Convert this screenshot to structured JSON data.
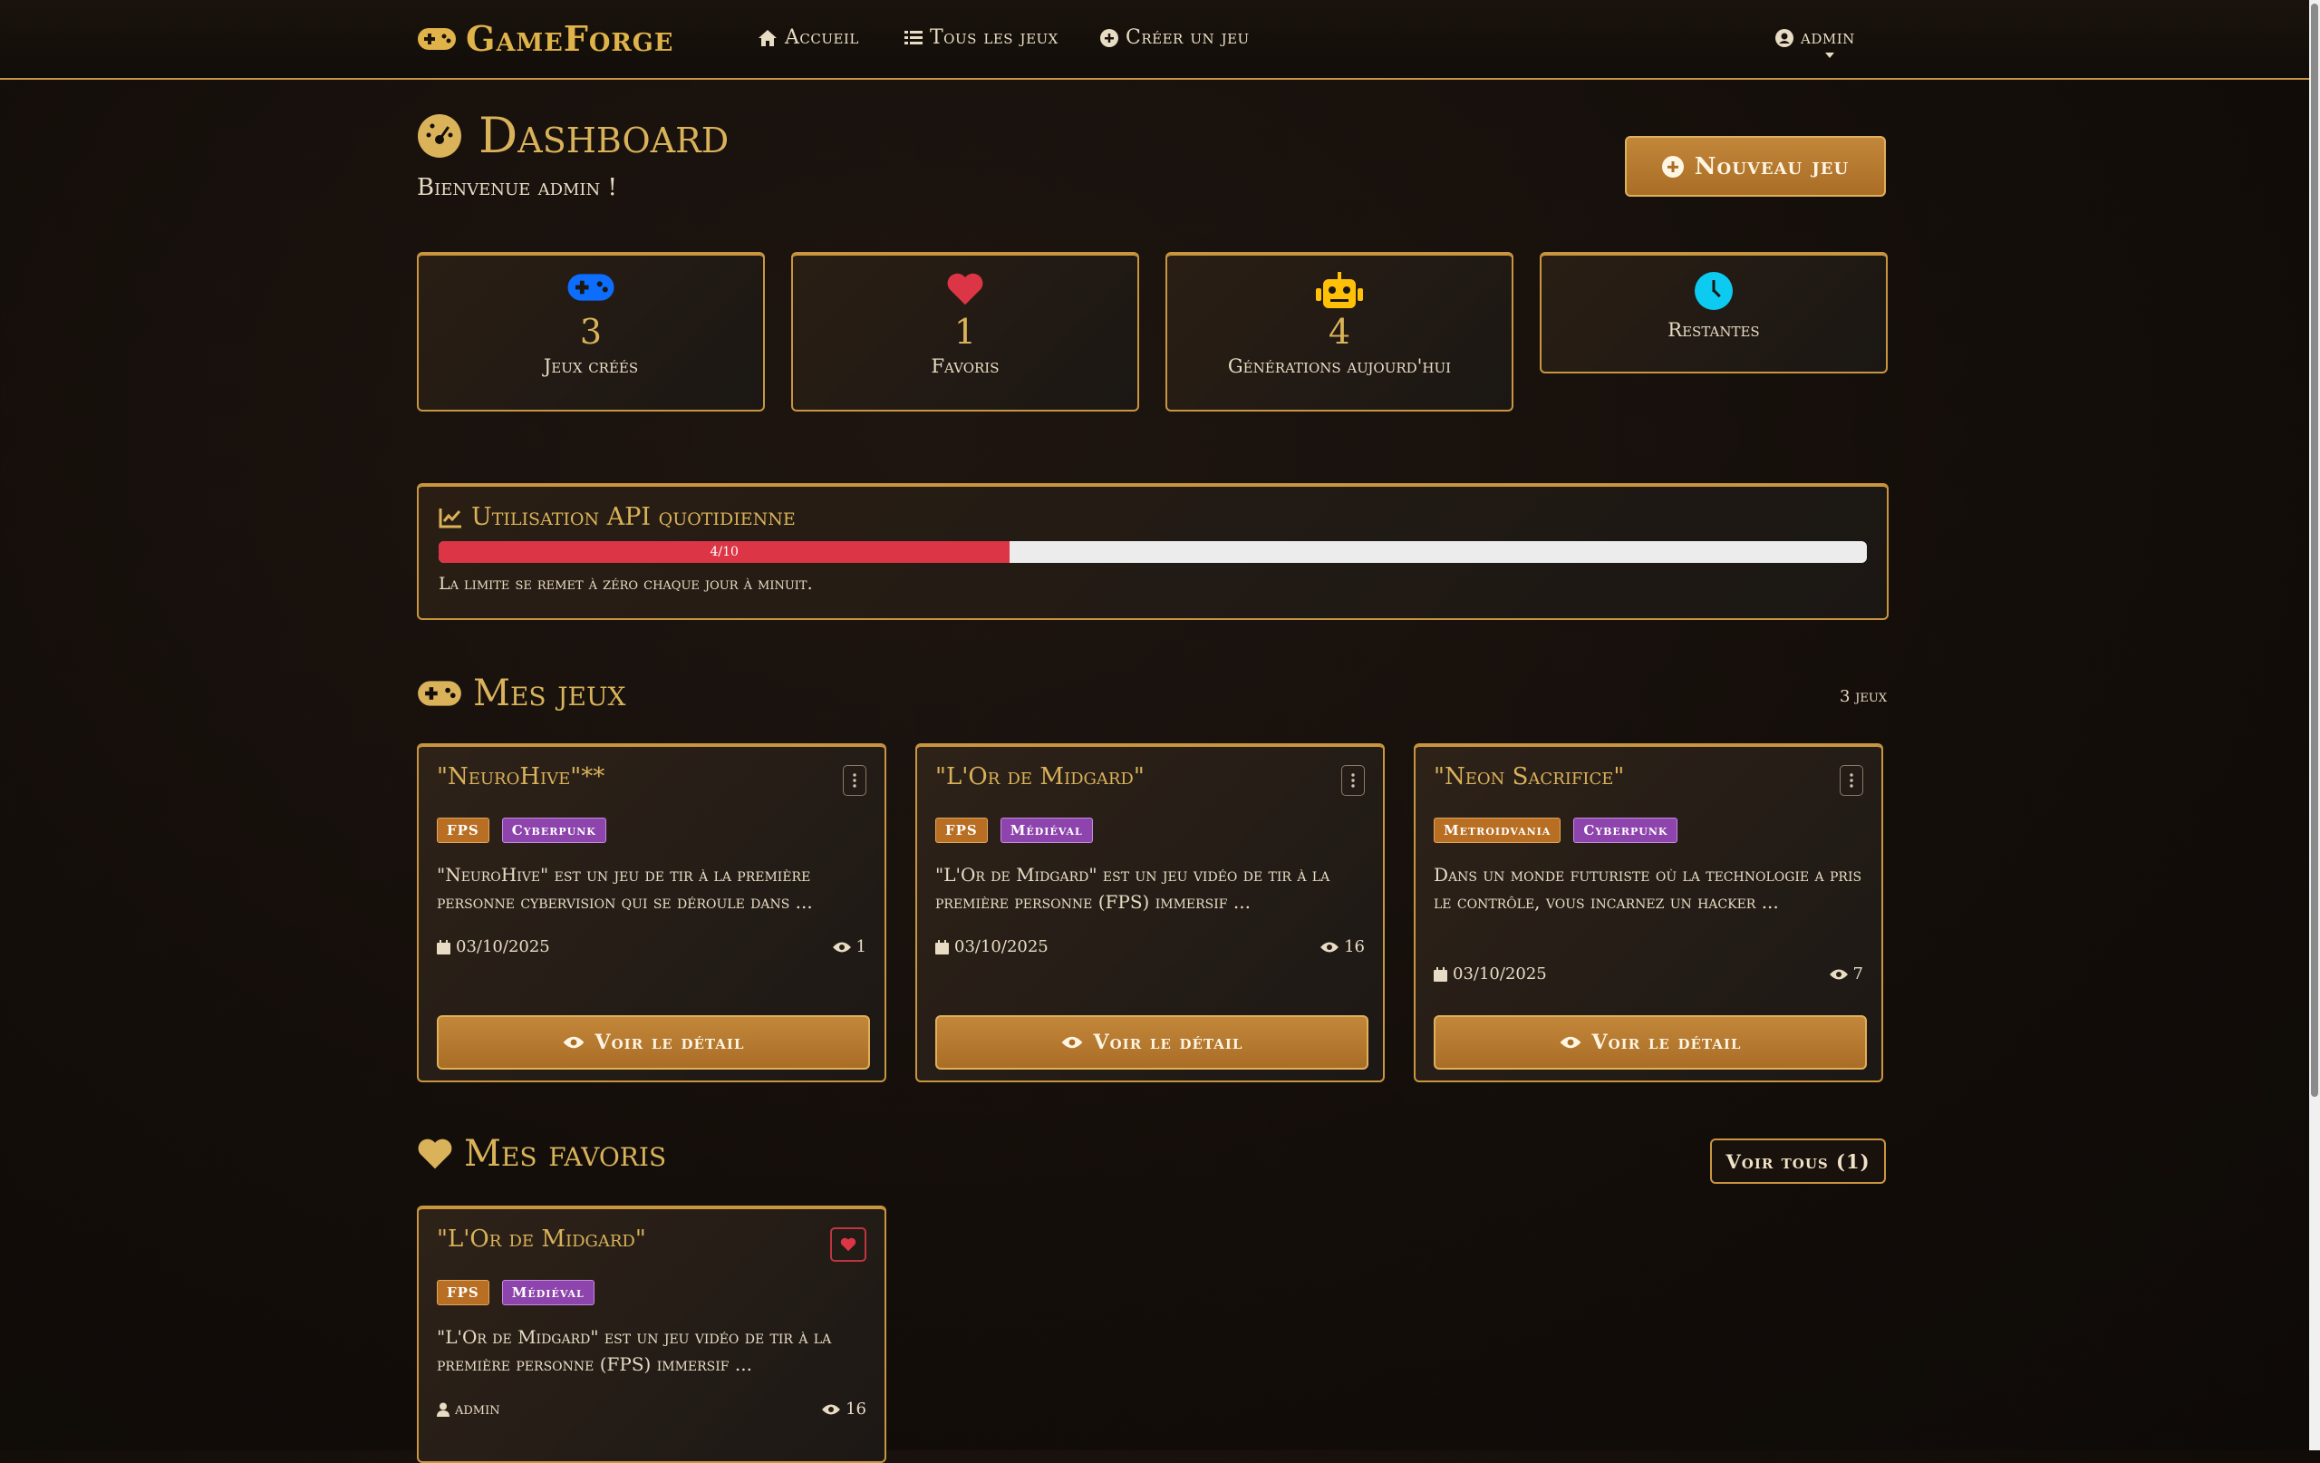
{
  "nav": {
    "brand": "GameForge",
    "links": [
      "Accueil",
      "Tous les jeux",
      "Créer un jeu"
    ],
    "user": "admin"
  },
  "header": {
    "title": "Dashboard",
    "welcome": "Bienvenue admin !",
    "new_game_label": "Nouveau jeu"
  },
  "stats": [
    {
      "value": "3",
      "label": "Jeux créés",
      "icon": "gamepad-icon",
      "color": "#0d6efd"
    },
    {
      "value": "1",
      "label": "Favoris",
      "icon": "heart-icon",
      "color": "#dc3545"
    },
    {
      "value": "4",
      "label": "Générations aujourd'hui",
      "icon": "robot-icon",
      "color": "#ffc107"
    },
    {
      "value": "",
      "label": "Restantes",
      "icon": "clock-icon",
      "color": "#0dcaf0"
    }
  ],
  "api": {
    "title": "Utilisation API quotidienne",
    "progress_label": "4/10",
    "progress_value": 0.4,
    "note": "La limite se remet à zéro chaque jour à minuit."
  },
  "my_games": {
    "title": "Mes jeux",
    "count": "3 jeux",
    "cards": [
      {
        "title": "\"NeuroHive\"**",
        "tags": [
          "FPS",
          "Cyberpunk"
        ],
        "desc": "\"NeuroHive\" est un jeu de tir à la première personne cybervision qui se déroule dans ...",
        "date": "03/10/2025",
        "views": "1",
        "button": "Voir le détail"
      },
      {
        "title": "\"L'Or de Midgard\"",
        "tags": [
          "FPS",
          "Médiéval"
        ],
        "desc": "\"L'Or de Midgard\" est un jeu vidéo de tir à la première personne (FPS) immersif ...",
        "date": "03/10/2025",
        "views": "16",
        "button": "Voir le détail"
      },
      {
        "title": "\"Neon Sacrifice\"",
        "tags": [
          "Metroidvania",
          "Cyberpunk"
        ],
        "desc": "Dans un monde futuriste où la technologie a pris le contrôle, vous incarnez un hacker ...",
        "date": "03/10/2025",
        "views": "7",
        "button": "Voir le détail"
      }
    ]
  },
  "favorites": {
    "title": "Mes favoris",
    "see_all": "Voir tous (1)",
    "cards": [
      {
        "title": "\"L'Or de Midgard\"",
        "tags": [
          "FPS",
          "Médiéval"
        ],
        "desc": "\"L'Or de Midgard\" est un jeu vidéo de tir à la première personne (FPS) immersif ...",
        "author": "admin",
        "views": "16"
      }
    ]
  }
}
